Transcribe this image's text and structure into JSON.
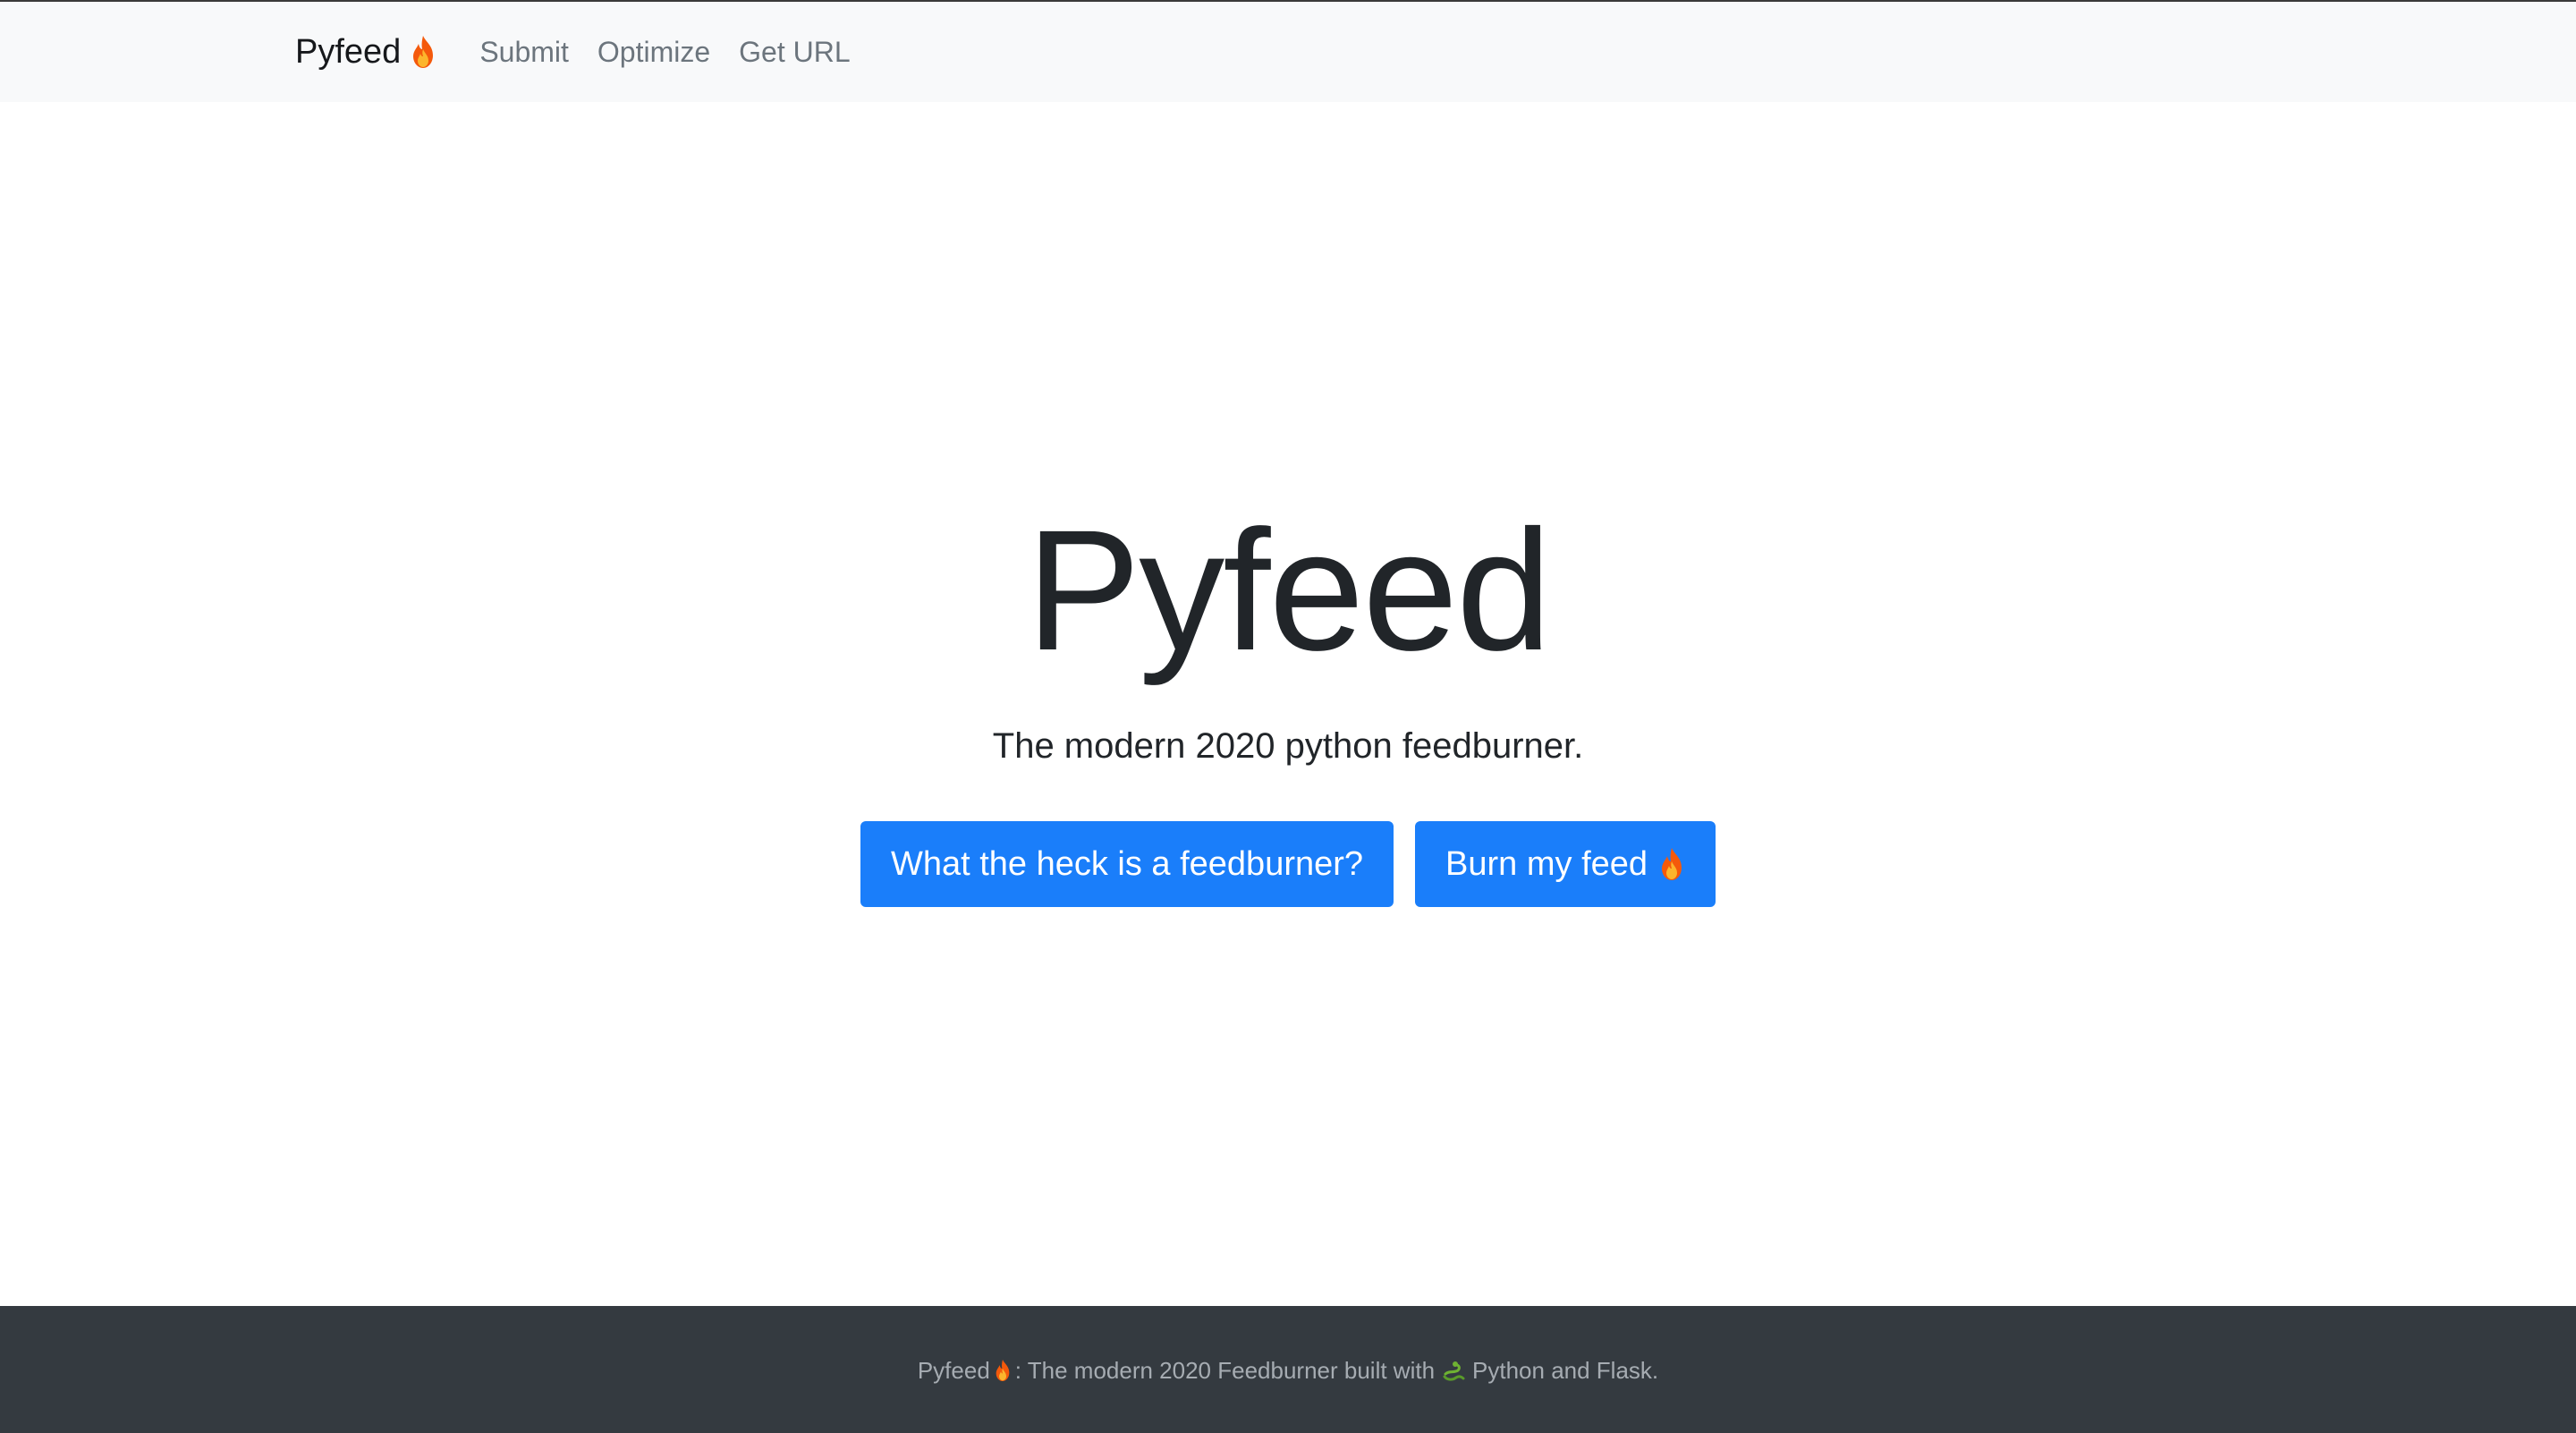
{
  "navbar": {
    "brand": "Pyfeed",
    "brand_icon": "fire-icon",
    "links": [
      "Submit",
      "Optimize",
      "Get URL"
    ]
  },
  "hero": {
    "title": "Pyfeed",
    "lead": "The modern 2020 python feedburner.",
    "buttons": [
      {
        "label": "What the heck is a feedburner?"
      },
      {
        "label": "Burn my feed",
        "icon": "fire-icon"
      }
    ]
  },
  "footer": {
    "brand": "Pyfeed",
    "text_middle": ": The modern 2020 Feedburner built with",
    "text_end": "Python and Flask.",
    "icons": [
      "fire-icon",
      "snake-icon"
    ]
  },
  "colors": {
    "navbar_bg": "#f8f9fa",
    "primary": "#1a7efa",
    "footer_bg": "#343a40",
    "footer_text": "#a6acb2",
    "text": "#212529"
  }
}
